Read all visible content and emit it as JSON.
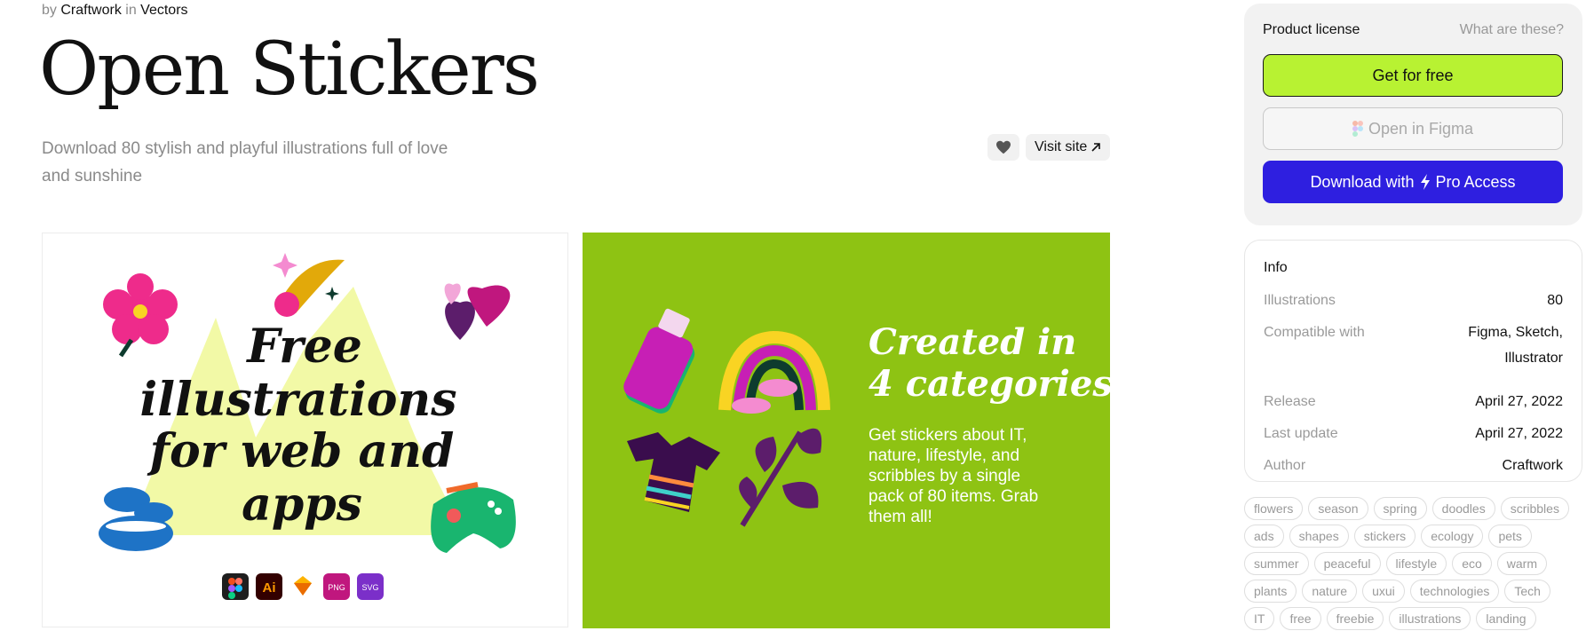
{
  "header": {
    "by_prefix": "by",
    "author": "Craftwork",
    "in_word": "in",
    "category": "Vectors",
    "title": "Open Stickers",
    "description": "Download 80 stylish and playful illustrations full of love and sunshine"
  },
  "actions": {
    "visit_label": "Visit site",
    "heart_icon": "heart-icon",
    "arrow_icon": "arrow-up-right-icon"
  },
  "preview1": {
    "headline_lines": [
      "Free",
      "illustrations",
      "for web and",
      "apps"
    ],
    "format_badges": [
      {
        "icon": "figma-icon",
        "label": "",
        "color": "#1e1e1e"
      },
      {
        "icon": "illustrator-icon",
        "label": "Ai",
        "color": "#330000"
      },
      {
        "icon": "sketch-icon",
        "label": "",
        "color": "#ffffff"
      },
      {
        "icon": "png-icon",
        "label": "PNG",
        "color": "#c0177e"
      },
      {
        "icon": "svg-icon",
        "label": "SVG",
        "color": "#7b2fc9"
      }
    ]
  },
  "preview2": {
    "heading_line1": "Created in",
    "heading_line2": "4 categories",
    "body_lines": [
      "Get stickers about IT,",
      "nature, lifestyle, and",
      "scribbles by a single",
      "pack of 80 items. Grab",
      "them all!"
    ],
    "bg_color": "#8ec313"
  },
  "license": {
    "label": "Product license",
    "help": "What are these?",
    "get_free": "Get for free",
    "open_figma": "Open in Figma",
    "download_pre": "Download with",
    "download_post": "Pro Access",
    "accent": "#b8f232",
    "pro_color": "#2e1fe0"
  },
  "info": {
    "title": "Info",
    "rows": [
      {
        "key": "Illustrations",
        "value": "80"
      },
      {
        "key": "Compatible with",
        "value": "Figma, Sketch,",
        "value2": "Illustrator"
      },
      {
        "key": "Release",
        "value": "April 27, 2022"
      },
      {
        "key": "Last update",
        "value": "April 27, 2022"
      },
      {
        "key": "Author",
        "value": "Craftwork"
      }
    ]
  },
  "tags": [
    "flowers",
    "season",
    "spring",
    "doodles",
    "scribbles",
    "ads",
    "shapes",
    "stickers",
    "ecology",
    "pets",
    "summer",
    "peaceful",
    "lifestyle",
    "eco",
    "warm",
    "plants",
    "nature",
    "uxui",
    "technologies",
    "Tech",
    "IT",
    "free",
    "freebie",
    "illustrations",
    "landing"
  ]
}
